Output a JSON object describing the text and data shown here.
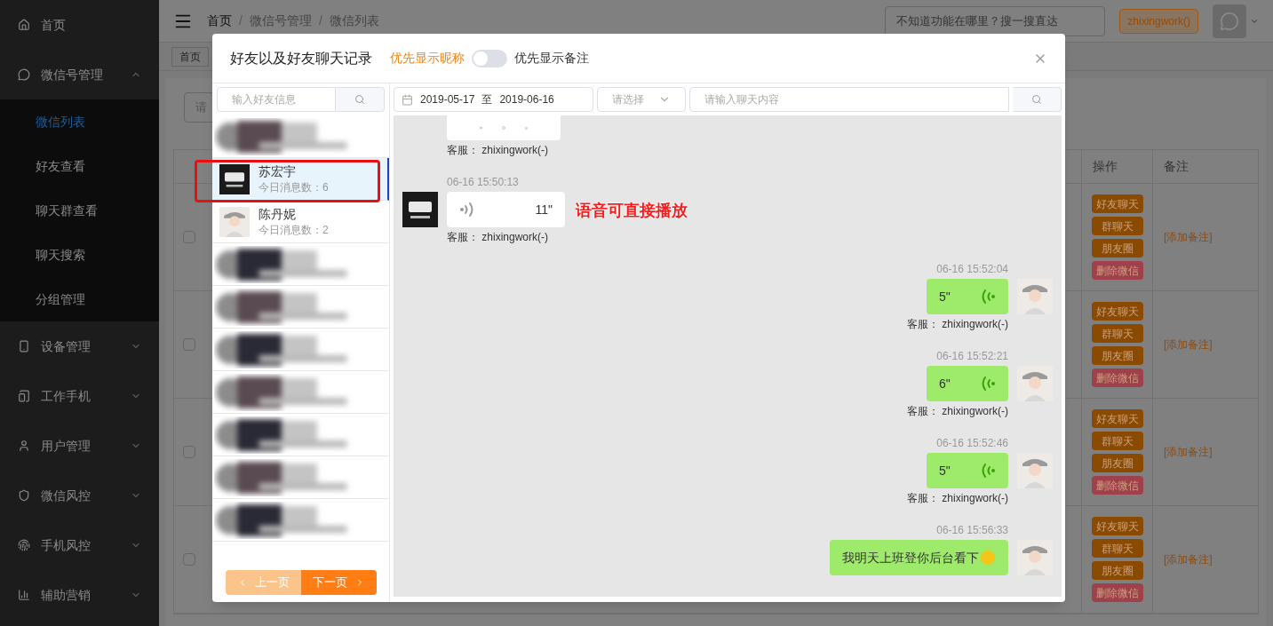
{
  "sidebar": {
    "items": [
      {
        "label": "首页"
      },
      {
        "label": "微信号管理",
        "expanded": true,
        "children": [
          {
            "label": "微信列表",
            "selected": true
          },
          {
            "label": "好友查看",
            "selected": false
          },
          {
            "label": "聊天群查看",
            "selected": false
          },
          {
            "label": "聊天搜索",
            "selected": false
          },
          {
            "label": "分组管理",
            "selected": false
          }
        ]
      },
      {
        "label": "设备管理",
        "expanded": false
      },
      {
        "label": "工作手机",
        "expanded": false
      },
      {
        "label": "用户管理",
        "expanded": false
      },
      {
        "label": "微信风控",
        "expanded": false
      },
      {
        "label": "手机风控",
        "expanded": false
      },
      {
        "label": "辅助营销",
        "expanded": false
      }
    ]
  },
  "topbar": {
    "breadcrumb": [
      "首页",
      "微信号管理",
      "微信列表"
    ],
    "breadcrumb_separator": "/",
    "search_placeholder": "不知道功能在哪里？搜一搜直达",
    "user": "zhixingwork()"
  },
  "background": {
    "tab": "首页",
    "field_placeholder": "请",
    "table": {
      "columns": [
        "操作",
        "备注"
      ],
      "rows": [
        {
          "actions": [
            {
              "label": "好友聊天",
              "kind": "normal"
            },
            {
              "label": "群聊天",
              "kind": "normal"
            },
            {
              "label": "朋友圈",
              "kind": "normal"
            },
            {
              "label": "删除微信",
              "kind": "danger"
            }
          ],
          "note": "[添加备注]",
          "checked": false
        },
        {
          "actions": [
            {
              "label": "好友聊天",
              "kind": "normal"
            },
            {
              "label": "群聊天",
              "kind": "normal"
            },
            {
              "label": "朋友圈",
              "kind": "normal"
            },
            {
              "label": "删除微信",
              "kind": "danger"
            }
          ],
          "note": "[添加备注]",
          "checked": false
        },
        {
          "actions": [
            {
              "label": "好友聊天",
              "kind": "normal"
            },
            {
              "label": "群聊天",
              "kind": "normal"
            },
            {
              "label": "朋友圈",
              "kind": "normal"
            },
            {
              "label": "删除微信",
              "kind": "danger"
            }
          ],
          "note": "[添加备注]",
          "checked": false
        },
        {
          "actions": [
            {
              "label": "好友聊天",
              "kind": "normal"
            },
            {
              "label": "群聊天",
              "kind": "normal"
            },
            {
              "label": "朋友圈",
              "kind": "normal"
            },
            {
              "label": "删除微信",
              "kind": "danger"
            }
          ],
          "note": "[添加备注]",
          "checked": false
        }
      ]
    }
  },
  "modal": {
    "title": "好友以及好友聊天记录",
    "display_options": [
      {
        "label": "优先显示昵称",
        "selected": true
      },
      {
        "label": "优先显示备注",
        "selected": false
      }
    ],
    "toggle": {
      "on": false
    },
    "friend_search_placeholder": "输入好友信息",
    "contacts": [
      {
        "kind": "blurred",
        "selected": false
      },
      {
        "kind": "contact",
        "name": "苏宏宇",
        "count": "今日消息数：6",
        "selected": true
      },
      {
        "kind": "contact",
        "name": "陈丹妮",
        "count": "今日消息数：2",
        "selected": false
      },
      {
        "kind": "blurred",
        "selected": false
      },
      {
        "kind": "blurred",
        "selected": false
      },
      {
        "kind": "blurred",
        "selected": false
      },
      {
        "kind": "blurred",
        "selected": false
      },
      {
        "kind": "blurred",
        "selected": false
      },
      {
        "kind": "blurred",
        "selected": false
      },
      {
        "kind": "blurred",
        "selected": false
      }
    ],
    "pagination": [
      {
        "label": "上一页",
        "disabled": true
      },
      {
        "label": "下一页",
        "disabled": false
      }
    ],
    "filters": {
      "date_start": "2019-05-17",
      "date_separator": "至",
      "date_end": "2019-06-16",
      "select_placeholder": "请选择",
      "search_placeholder": "请输入聊天内容"
    },
    "annotation": "语音可直接播放",
    "messages": [
      {
        "kind": "partial_in",
        "sender": "客服： zhixingwork(-)"
      },
      {
        "kind": "voice_in",
        "time": "06-16 15:50:13",
        "duration": "11\"",
        "sender": "客服： zhixingwork(-)"
      },
      {
        "kind": "voice_out",
        "time": "06-16 15:52:04",
        "duration": "5\"",
        "sender": "客服： zhixingwork(-)"
      },
      {
        "kind": "voice_out",
        "time": "06-16 15:52:21",
        "duration": "6\"",
        "sender": "客服： zhixingwork(-)"
      },
      {
        "kind": "voice_out",
        "time": "06-16 15:52:46",
        "duration": "5\"",
        "sender": "客服： zhixingwork(-)"
      },
      {
        "kind": "text_out",
        "time": "06-16 15:56:33",
        "text": "我明天上班登你后台看下"
      }
    ]
  }
}
